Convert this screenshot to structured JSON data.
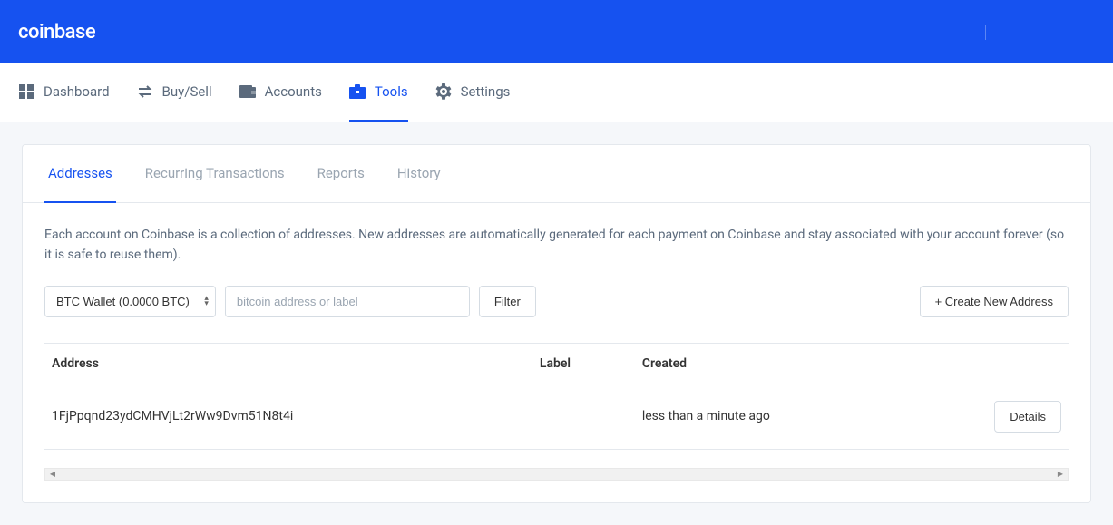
{
  "header": {
    "logo": "coinbase"
  },
  "nav": {
    "items": [
      {
        "label": "Dashboard",
        "active": false
      },
      {
        "label": "Buy/Sell",
        "active": false
      },
      {
        "label": "Accounts",
        "active": false
      },
      {
        "label": "Tools",
        "active": true
      },
      {
        "label": "Settings",
        "active": false
      }
    ]
  },
  "subtabs": {
    "items": [
      {
        "label": "Addresses",
        "active": true
      },
      {
        "label": "Recurring Transactions",
        "active": false
      },
      {
        "label": "Reports",
        "active": false
      },
      {
        "label": "History",
        "active": false
      }
    ]
  },
  "page": {
    "description": "Each account on Coinbase is a collection of addresses. New addresses are automatically generated for each payment on Coinbase and stay associated with your account forever (so it is safe to reuse them).",
    "wallet_selected": "BTC Wallet (0.0000 BTC)",
    "search_placeholder": "bitcoin address or label",
    "filter_button": "Filter",
    "create_button": "+  Create New Address"
  },
  "table": {
    "headers": {
      "address": "Address",
      "label": "Label",
      "created": "Created",
      "actions": ""
    },
    "rows": [
      {
        "address": "1FjPpqnd23ydCMHVjLt2rWw9Dvm51N8t4i",
        "label": "",
        "created": "less than a minute ago",
        "details": "Details"
      }
    ]
  }
}
